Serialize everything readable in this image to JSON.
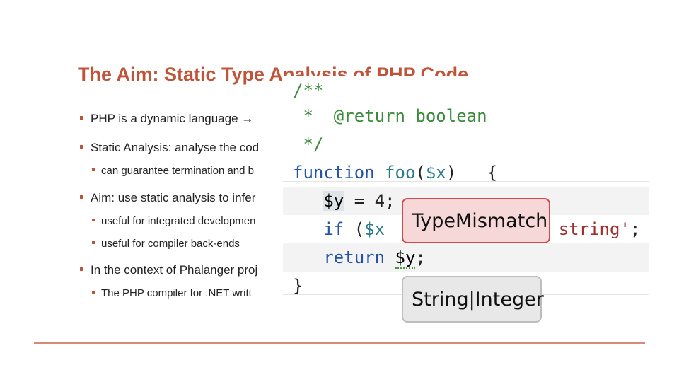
{
  "slide": {
    "title": "The Aim: Static Type Analysis of PHP Code",
    "bullets": [
      {
        "text": "PHP is a dynamic language →",
        "sub": []
      },
      {
        "text": "Static Analysis: analyse the cod",
        "sub": [
          "can guarantee termination and b"
        ]
      },
      {
        "text": "Aim: use static analysis to infer",
        "sub": [
          "useful for integrated developmen",
          "useful for compiler back-ends"
        ]
      },
      {
        "text": "In the context of Phalanger proj",
        "sub": [
          "The PHP compiler for .NET writt"
        ]
      }
    ]
  },
  "code": {
    "lines": [
      {
        "parts": [
          [
            "green",
            "/**"
          ]
        ]
      },
      {
        "parts": [
          [
            "green",
            " *  @return boolean"
          ]
        ]
      },
      {
        "parts": [
          [
            "green",
            " */"
          ]
        ]
      },
      {
        "parts": [
          [
            "kw",
            "function"
          ],
          [
            "dark",
            " "
          ],
          [
            "var",
            "foo"
          ],
          [
            "dark",
            "("
          ],
          [
            "var",
            "$x"
          ],
          [
            "dark",
            ")   {"
          ]
        ]
      },
      {
        "parts": [
          [
            "dark",
            "   "
          ],
          [
            "hl",
            "$y"
          ],
          [
            "dark",
            " = "
          ],
          [
            "num",
            "4"
          ],
          [
            "dark",
            ";"
          ]
        ]
      },
      {
        "parts": [
          [
            "dark",
            "   "
          ],
          [
            "kw",
            "if"
          ],
          [
            "dark",
            " ("
          ],
          [
            "var",
            "$x"
          ],
          [
            "dark",
            "                 "
          ],
          [
            "str",
            "string'"
          ],
          [
            "dark",
            ";"
          ]
        ]
      },
      {
        "parts": [
          [
            "dark",
            "   "
          ],
          [
            "kw",
            "return"
          ],
          [
            "dark",
            " "
          ],
          [
            "squig",
            "$y"
          ],
          [
            "dark",
            ";"
          ]
        ]
      },
      {
        "parts": [
          [
            "dark",
            "}"
          ]
        ]
      }
    ],
    "tooltip_error": "TypeMismatch",
    "tooltip_type": "String|Integer"
  }
}
